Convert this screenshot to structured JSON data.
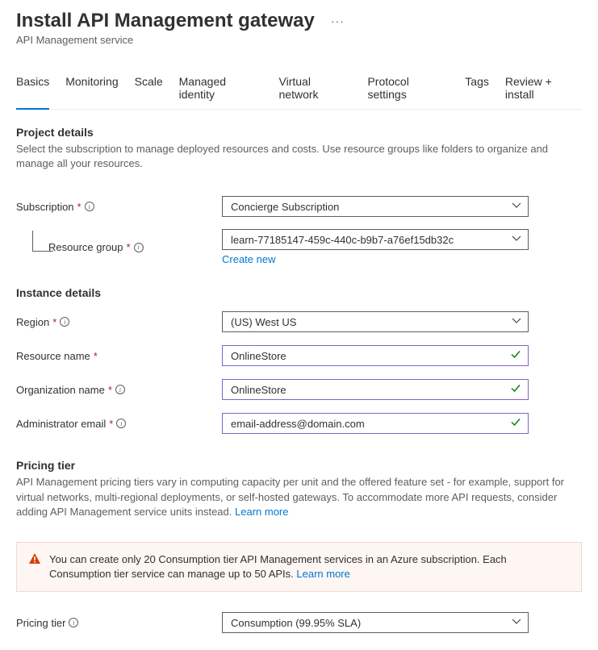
{
  "header": {
    "title": "Install API Management gateway",
    "subtitle": "API Management service"
  },
  "tabs": {
    "items": [
      {
        "label": "Basics",
        "active": true
      },
      {
        "label": "Monitoring"
      },
      {
        "label": "Scale"
      },
      {
        "label": "Managed identity"
      },
      {
        "label": "Virtual network"
      },
      {
        "label": "Protocol settings"
      },
      {
        "label": "Tags"
      },
      {
        "label": "Review + install"
      }
    ]
  },
  "project": {
    "title": "Project details",
    "desc": "Select the subscription to manage deployed resources and costs. Use resource groups like folders to organize and manage all your resources.",
    "subscription_label": "Subscription",
    "subscription_value": "Concierge Subscription",
    "resource_group_label": "Resource group",
    "resource_group_value": "learn-77185147-459c-440c-b9b7-a76ef15db32c",
    "create_new": "Create new"
  },
  "instance": {
    "title": "Instance details",
    "region_label": "Region",
    "region_value": "(US) West US",
    "resource_name_label": "Resource name",
    "resource_name_value": "OnlineStore",
    "org_name_label": "Organization name",
    "org_name_value": "OnlineStore",
    "admin_email_label": "Administrator email",
    "admin_email_value": "email-address@domain.com"
  },
  "pricing": {
    "title": "Pricing tier",
    "desc": "API Management pricing tiers vary in computing capacity per unit and the offered feature set - for example, support for virtual networks, multi-regional deployments, or self-hosted gateways. To accommodate more API requests, consider adding API Management service units instead. ",
    "learn_more": "Learn more",
    "banner": "You can create only 20 Consumption tier API Management services in an Azure subscription. Each Consumption tier service can manage up to 50 APIs. ",
    "banner_learn_more": "Learn more",
    "tier_label": "Pricing tier",
    "tier_value": "Consumption (99.95% SLA)"
  }
}
